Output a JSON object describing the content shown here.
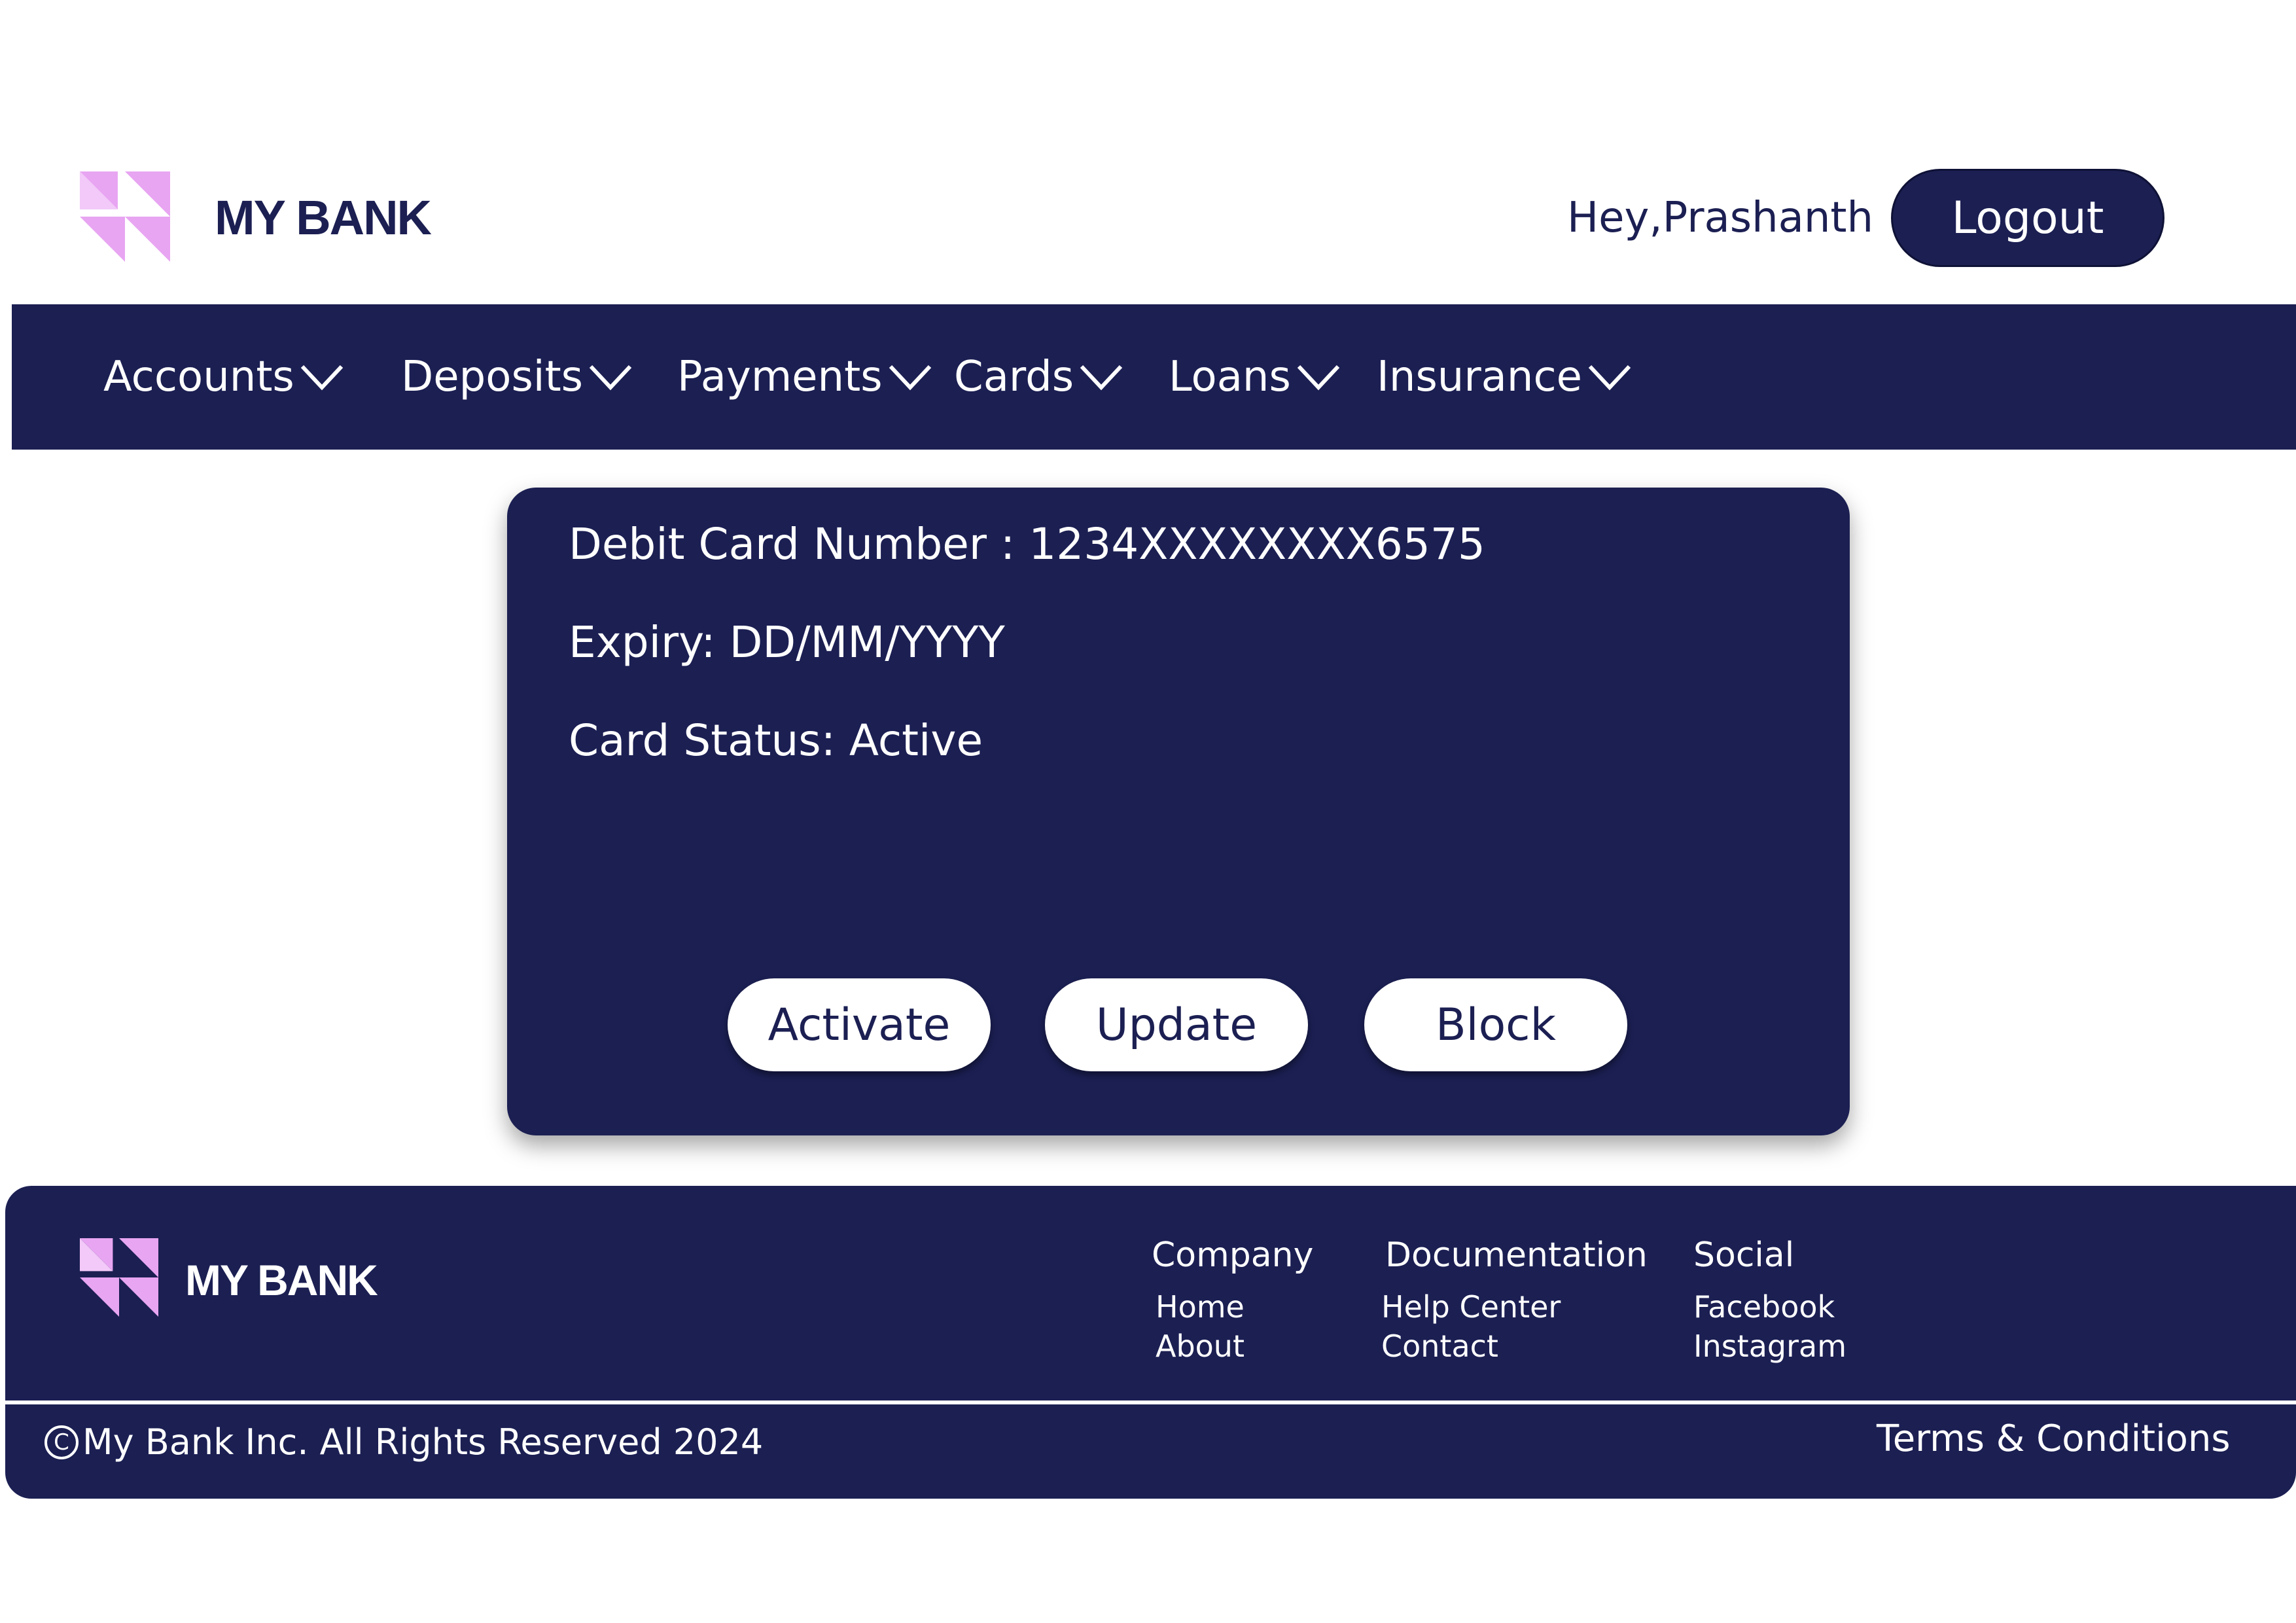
{
  "brand": {
    "name": "MY BANK",
    "logo_icon": "bank-logo-icon",
    "accent_color": "#e8a5f2"
  },
  "header": {
    "greeting": "Hey,Prashanth",
    "logout_label": "Logout"
  },
  "nav": {
    "items": [
      {
        "label": "Accounts",
        "icon": "chevron-down-icon"
      },
      {
        "label": "Deposits",
        "icon": "chevron-down-icon"
      },
      {
        "label": "Payments",
        "icon": "chevron-down-icon"
      },
      {
        "label": "Cards",
        "icon": "chevron-down-icon"
      },
      {
        "label": "Loans",
        "icon": "chevron-down-icon"
      },
      {
        "label": "Insurance",
        "icon": "chevron-down-icon"
      }
    ]
  },
  "card": {
    "number_line": "Debit Card Number : 1234XXXXXXXX6575",
    "expiry_line": "Expiry: DD/MM/YYYY",
    "status_line": "Card Status: Active",
    "actions": {
      "activate": "Activate",
      "update": "Update",
      "block": "Block"
    }
  },
  "footer": {
    "brand": "MY BANK",
    "columns": [
      {
        "title": "Company",
        "links": [
          "Home",
          "About"
        ]
      },
      {
        "title": "Documentation",
        "links": [
          "Help Center",
          "Contact"
        ]
      },
      {
        "title": "Social",
        "links": [
          "Facebook",
          "Instagram"
        ]
      }
    ],
    "copyright_symbol": "C",
    "copyright": "My Bank Inc. All Rights Reserved 2024",
    "terms": "Terms & Conditions"
  },
  "colors": {
    "primary": "#1b1f52",
    "background": "#ffffff",
    "on_primary": "#ffffff"
  }
}
